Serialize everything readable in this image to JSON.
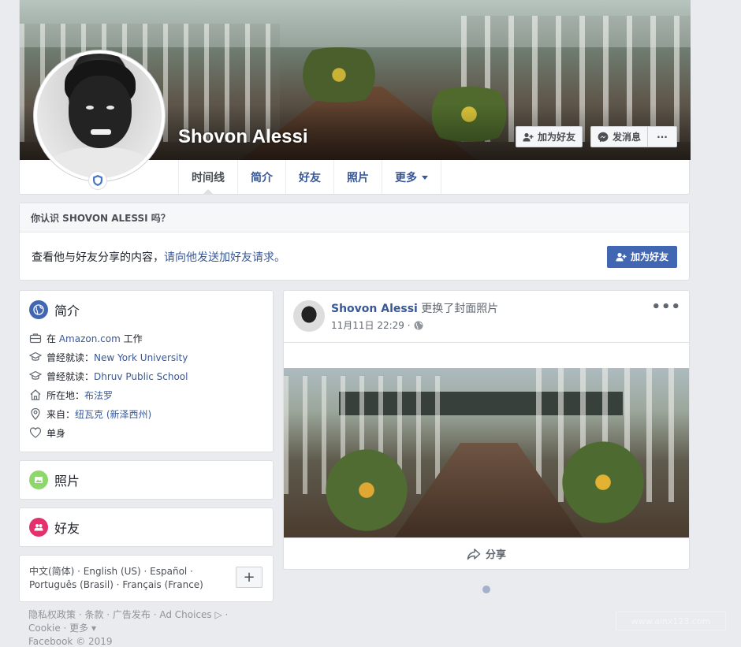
{
  "profile": {
    "name": "Shovon Alessi"
  },
  "cover_actions": {
    "add_friend": "加为好友",
    "message": "发消息",
    "more": "···"
  },
  "tabs": [
    "时间线",
    "简介",
    "好友",
    "照片",
    "更多"
  ],
  "know": {
    "header": "你认识 SHOVON ALESSI 吗？",
    "text": "查看他与好友分享的内容，",
    "link": "请向他发送加好友请求。",
    "button": "加为好友"
  },
  "intro": {
    "title": "简介",
    "rows": [
      {
        "icon": "briefcase-icon",
        "prefix": "在 ",
        "link": "Amazon.com",
        "suffix": " 工作"
      },
      {
        "icon": "education-icon",
        "prefix": "曾经就读：",
        "link": "New York University",
        "suffix": ""
      },
      {
        "icon": "education-icon",
        "prefix": "曾经就读：",
        "link": "Dhruv Public School",
        "suffix": ""
      },
      {
        "icon": "home-icon",
        "prefix": "所在地：",
        "link": "布法罗",
        "suffix": ""
      },
      {
        "icon": "location-pin-icon",
        "prefix": "来自：",
        "link": "纽瓦克 (新泽西州)",
        "suffix": ""
      },
      {
        "icon": "heart-icon",
        "prefix": "单身",
        "link": "",
        "suffix": ""
      }
    ]
  },
  "photos": {
    "title": "照片"
  },
  "friends": {
    "title": "好友"
  },
  "languages": {
    "line1": "中文(简体) · English (US) · Español ·",
    "line2": "Português (Brasil) · Français (France)",
    "plus": "+"
  },
  "footer": {
    "line1": "隐私权政策 · 条款 · 广告发布 · Ad Choices ▷ ·",
    "line2": "Cookie · 更多 ▾",
    "line3": "Facebook © 2019"
  },
  "post": {
    "author": "Shovon Alessi",
    "action": " 更换了封面照片",
    "time": "11月11日 22:29 · ",
    "more": "•••",
    "share": "分享"
  },
  "watermark": "www.ainx123.com",
  "colors": {
    "fb_blue": "#4267b2",
    "link": "#385898",
    "background": "#e9ebee"
  }
}
